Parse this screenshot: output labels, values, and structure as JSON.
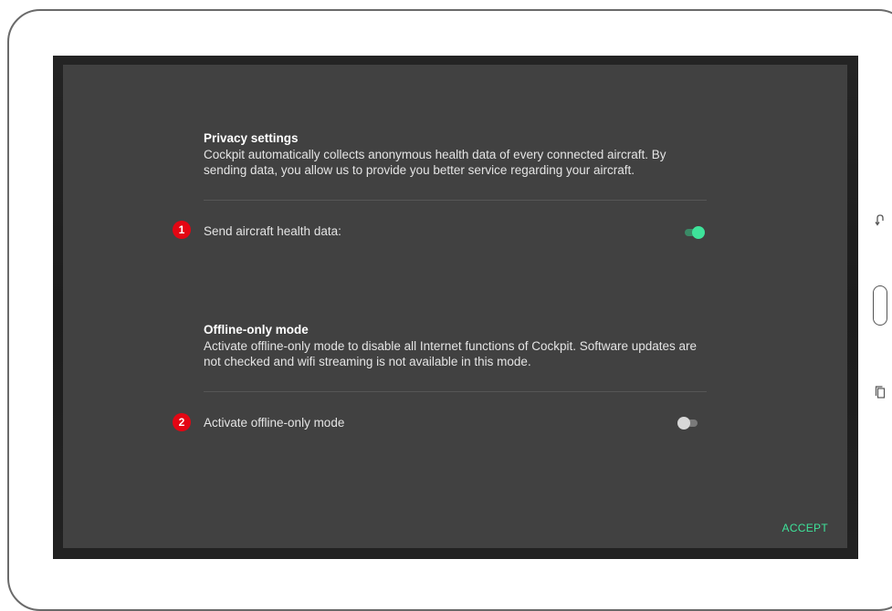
{
  "privacy": {
    "title": "Privacy settings",
    "description": "Cockpit automatically collects anonymous health data of every connected aircraft. By sending data, you allow us to provide you better service regarding your aircraft.",
    "badge": "1",
    "option_label": "Send aircraft health data:",
    "toggle_on": true
  },
  "offline": {
    "title": "Offline-only mode",
    "description": "Activate offline-only mode to disable all Internet functions of Cockpit. Software updates are not checked and wifi streaming is not available in this mode.",
    "badge": "2",
    "option_label": "Activate offline-only mode",
    "toggle_on": false
  },
  "actions": {
    "accept_label": "ACCEPT"
  },
  "device": {
    "back_icon": "back-icon",
    "recents_icon": "recents-icon"
  },
  "colors": {
    "dialog_bg": "#414141",
    "accent": "#3ee39a",
    "badge": "#e30613"
  }
}
